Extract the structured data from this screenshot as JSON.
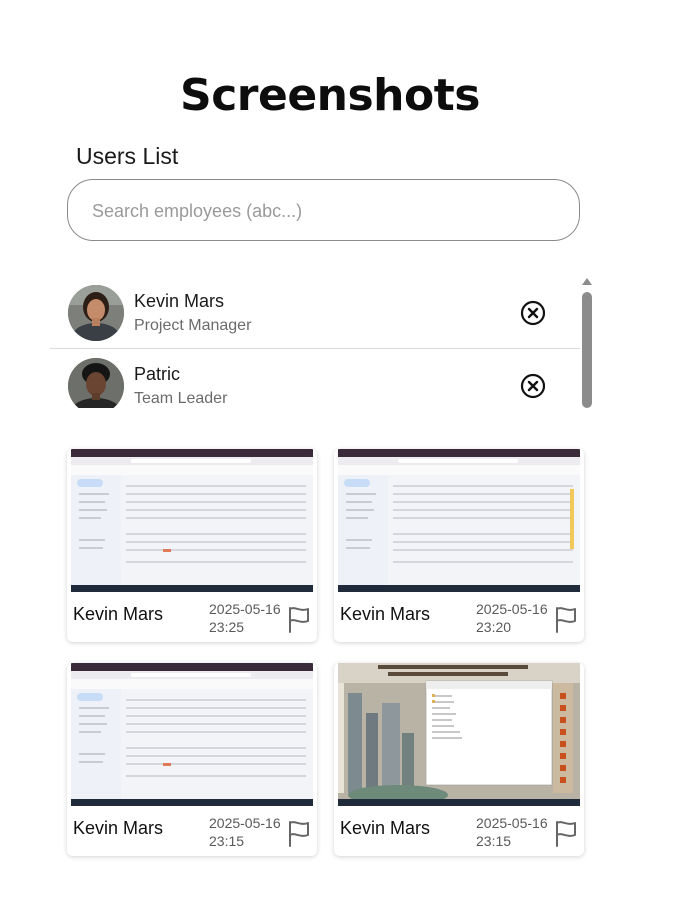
{
  "page": {
    "title": "Screenshots"
  },
  "users": {
    "heading": "Users List",
    "search_placeholder": "Search employees (abc...)",
    "items": [
      {
        "name": "Kevin Mars",
        "role": "Project Manager"
      },
      {
        "name": "Patric",
        "role": "Team Leader"
      }
    ]
  },
  "screenshots": [
    {
      "user": "Kevin Mars",
      "date": "2025-05-16",
      "time": "23:25",
      "thumbnail": "browser-email-inbox"
    },
    {
      "user": "Kevin Mars",
      "date": "2025-05-16",
      "time": "23:20",
      "thumbnail": "browser-email-inbox"
    },
    {
      "user": "Kevin Mars",
      "date": "2025-05-16",
      "time": "23:15",
      "thumbnail": "browser-email-inbox"
    },
    {
      "user": "Kevin Mars",
      "date": "2025-05-16",
      "time": "23:15",
      "thumbnail": "desktop-file-explorer"
    }
  ],
  "colors": {
    "border": "#8a8a8a",
    "muted_text": "#6b6b6b",
    "scrollbar": "#8c8c8c"
  }
}
